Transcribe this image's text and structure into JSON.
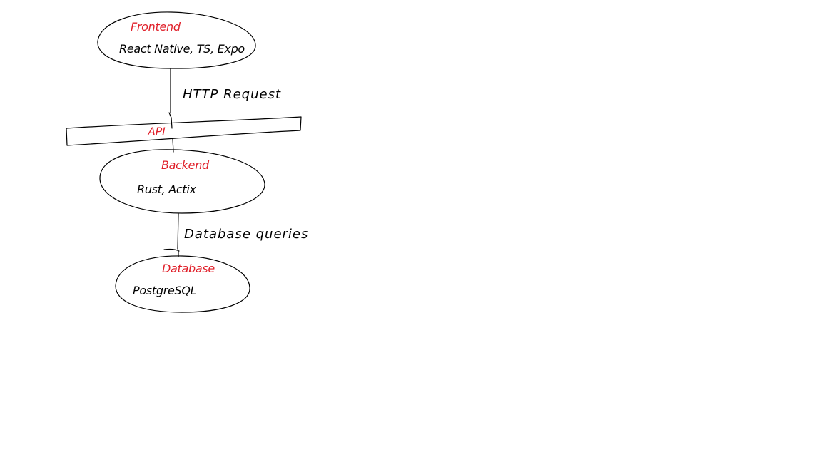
{
  "colors": {
    "ink": "#000000",
    "accent": "#e0202a",
    "background": "#ffffff"
  },
  "nodes": {
    "frontend": {
      "title": "Frontend",
      "subtitle": "React Native, TS, Expo"
    },
    "api": {
      "title": "API"
    },
    "backend": {
      "title": "Backend",
      "subtitle": "Rust, Actix"
    },
    "database": {
      "title": "Database",
      "subtitle": "PostgreSQL"
    }
  },
  "edges": {
    "frontend_to_api": {
      "label": "HTTP Request"
    },
    "backend_to_database": {
      "label": "Database queries"
    }
  }
}
